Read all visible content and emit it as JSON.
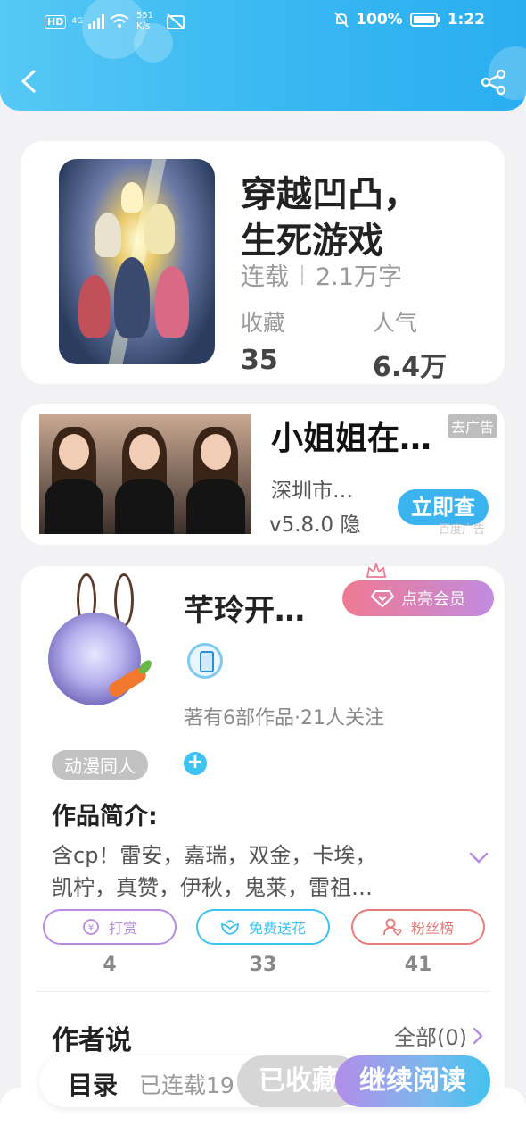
{
  "status_bar": {
    "hd": "HD",
    "signal": "4G",
    "speed_value": "551",
    "speed_unit": "K/s",
    "battery": "100%",
    "time": "1:22"
  },
  "header": {
    "back_icon": "back-arrow-icon",
    "share_icon": "share-icon"
  },
  "book": {
    "title_line1": "穿越凹凸，",
    "title_line2": "生死游戏",
    "status": "连载",
    "word_count": "2.1万字",
    "favorites_label": "收藏",
    "favorites_value": "35",
    "popularity_label": "人气",
    "popularity_value": "6.4万"
  },
  "ad": {
    "title": "小姐姐在…",
    "tag": "去广告",
    "company": "深圳市…",
    "version": "v5.8.0 隐",
    "button": "立即查",
    "source": "百度广告"
  },
  "author": {
    "name": "芊玲开…",
    "vip_button": "点亮会员",
    "works_info": "著有6部作品·21人关注",
    "genre_tag": "动漫同人",
    "intro_heading": "作品简介:",
    "intro_line1": "含cp！雷安，嘉瑞，双金，卡埃，",
    "intro_line2": "凯柠，真赞，伊秋，鬼莱，雷祖…",
    "actions": [
      {
        "label": "打赏",
        "count": "4",
        "color": "#b98be0"
      },
      {
        "label": "免费送花",
        "count": "33",
        "color": "#3fc1f2"
      },
      {
        "label": "粉丝榜",
        "count": "41",
        "color": "#e97a7a"
      }
    ],
    "says_heading": "作者说",
    "all_link": "全部(0)"
  },
  "bottom": {
    "toc_label": "目录",
    "progress": "已连载19",
    "favorite_button": "已收藏",
    "read_button": "继续阅读"
  }
}
